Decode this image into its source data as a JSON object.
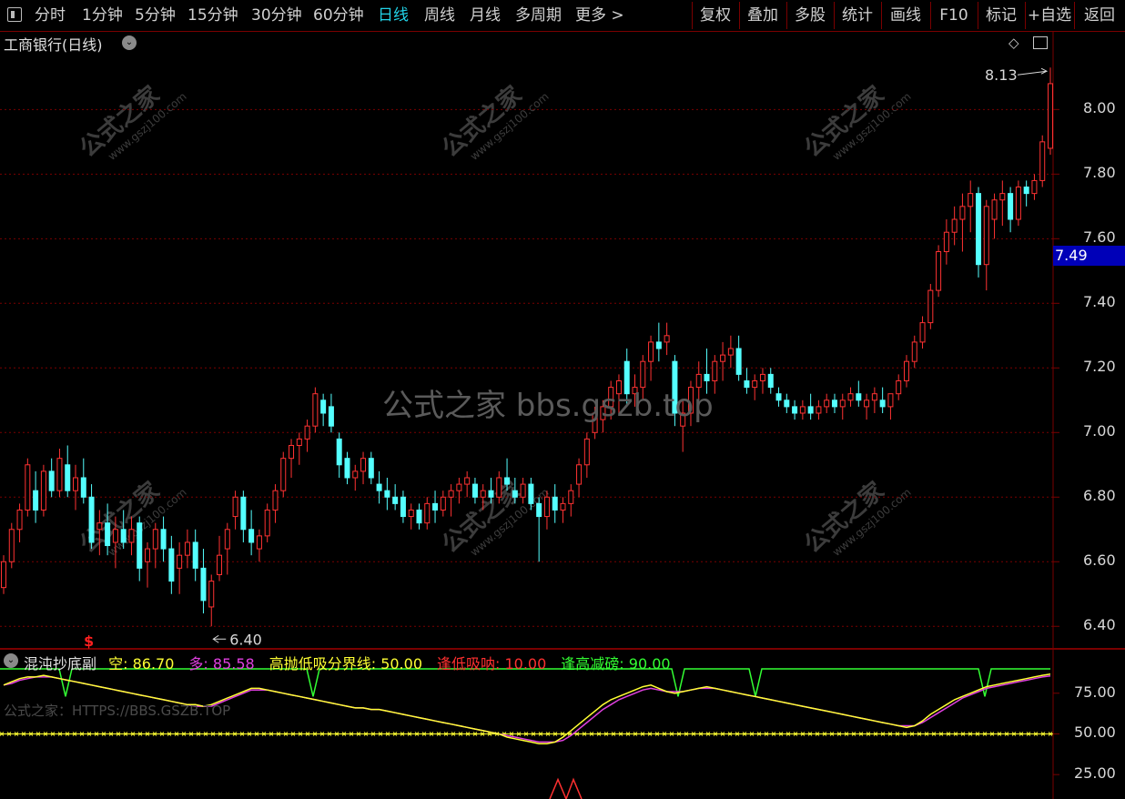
{
  "toolbar": {
    "left_items": [
      {
        "label": "分时",
        "active": false
      },
      {
        "label": "1分钟",
        "active": false
      },
      {
        "label": "5分钟",
        "active": false
      },
      {
        "label": "15分钟",
        "active": false
      },
      {
        "label": "30分钟",
        "active": false
      },
      {
        "label": "60分钟",
        "active": false
      },
      {
        "label": "日线",
        "active": true
      },
      {
        "label": "周线",
        "active": false
      },
      {
        "label": "月线",
        "active": false
      },
      {
        "label": "多周期",
        "active": false
      },
      {
        "label": "更多 >",
        "active": false
      }
    ],
    "right_items": [
      "复权",
      "叠加",
      "多股",
      "统计",
      "画线",
      "F10",
      "标记",
      "+自选",
      "返回"
    ]
  },
  "chart": {
    "title": "工商银行(日线)",
    "current_price": "7.49",
    "high_label": "8.13",
    "low_label": "6.40",
    "signal_marker": "$",
    "watermark_center": "公式之家 bbs.gszb.top",
    "watermark_cn": "公式之家",
    "watermark_url": "www.gszj100.com",
    "price_ticks": [
      "8.00",
      "7.80",
      "7.60",
      "7.40",
      "7.20",
      "7.00",
      "6.80",
      "6.60",
      "6.40"
    ]
  },
  "indicator": {
    "name": "混沌抄底副",
    "fields": [
      {
        "label": "空: ",
        "value": "86.70",
        "color": "#ffff33"
      },
      {
        "label": "多: ",
        "value": "85.58",
        "color": "#e040e0"
      },
      {
        "label": "高抛低吸分界线: ",
        "value": "50.00",
        "color": "#ffff33"
      },
      {
        "label": "逢低吸呐: ",
        "value": "10.00",
        "color": "#ff3030"
      },
      {
        "label": "逢高减磅: ",
        "value": "90.00",
        "color": "#33ff33"
      }
    ],
    "axis_ticks": [
      "75.00",
      "50.00",
      "25.00"
    ],
    "watermark": "公式之家：HTTPS://BBS.GSZB.TOP"
  },
  "colors": {
    "up": "#ff3232",
    "down": "#54ffff",
    "grid": "#7a0000",
    "kong_line": "#ffff33",
    "duo_line": "#e040e0",
    "high_sell": "#33ff33",
    "low_buy": "#ff3030"
  },
  "chart_data": {
    "type": "candlestick",
    "ylim": [
      6.35,
      8.17
    ],
    "candles": [
      [
        6.52,
        6.62,
        6.5,
        6.6
      ],
      [
        6.6,
        6.72,
        6.58,
        6.7
      ],
      [
        6.7,
        6.78,
        6.66,
        6.76
      ],
      [
        6.76,
        6.92,
        6.74,
        6.9
      ],
      [
        6.82,
        6.88,
        6.72,
        6.76
      ],
      [
        6.76,
        6.9,
        6.74,
        6.88
      ],
      [
        6.88,
        6.92,
        6.8,
        6.82
      ],
      [
        6.82,
        6.95,
        6.8,
        6.92
      ],
      [
        6.9,
        6.96,
        6.8,
        6.82
      ],
      [
        6.82,
        6.9,
        6.76,
        6.86
      ],
      [
        6.86,
        6.92,
        6.78,
        6.8
      ],
      [
        6.8,
        6.84,
        6.64,
        6.66
      ],
      [
        6.7,
        6.76,
        6.62,
        6.72
      ],
      [
        6.72,
        6.78,
        6.62,
        6.65
      ],
      [
        6.66,
        6.74,
        6.58,
        6.7
      ],
      [
        6.7,
        6.76,
        6.64,
        6.66
      ],
      [
        6.66,
        6.74,
        6.62,
        6.7
      ],
      [
        6.72,
        6.74,
        6.54,
        6.58
      ],
      [
        6.6,
        6.66,
        6.52,
        6.64
      ],
      [
        6.64,
        6.72,
        6.58,
        6.7
      ],
      [
        6.7,
        6.74,
        6.6,
        6.64
      ],
      [
        6.64,
        6.68,
        6.5,
        6.54
      ],
      [
        6.58,
        6.66,
        6.5,
        6.62
      ],
      [
        6.62,
        6.7,
        6.58,
        6.66
      ],
      [
        6.66,
        6.7,
        6.54,
        6.58
      ],
      [
        6.58,
        6.64,
        6.44,
        6.48
      ],
      [
        6.46,
        6.56,
        6.4,
        6.54
      ],
      [
        6.56,
        6.68,
        6.54,
        6.62
      ],
      [
        6.64,
        6.72,
        6.56,
        6.7
      ],
      [
        6.74,
        6.82,
        6.7,
        6.8
      ],
      [
        6.8,
        6.82,
        6.66,
        6.7
      ],
      [
        6.7,
        6.76,
        6.62,
        6.66
      ],
      [
        6.64,
        6.7,
        6.6,
        6.68
      ],
      [
        6.68,
        6.78,
        6.66,
        6.76
      ],
      [
        6.76,
        6.84,
        6.72,
        6.82
      ],
      [
        6.82,
        6.94,
        6.8,
        6.92
      ],
      [
        6.92,
        6.98,
        6.86,
        6.96
      ],
      [
        6.96,
        7.0,
        6.9,
        6.98
      ],
      [
        6.98,
        7.04,
        6.94,
        7.02
      ],
      [
        7.02,
        7.14,
        7.0,
        7.12
      ],
      [
        7.1,
        7.12,
        7.02,
        7.06
      ],
      [
        7.08,
        7.12,
        7.0,
        7.02
      ],
      [
        6.98,
        7.0,
        6.86,
        6.9
      ],
      [
        6.92,
        6.94,
        6.84,
        6.86
      ],
      [
        6.86,
        6.9,
        6.82,
        6.88
      ],
      [
        6.88,
        6.94,
        6.84,
        6.92
      ],
      [
        6.92,
        6.94,
        6.84,
        6.86
      ],
      [
        6.84,
        6.88,
        6.78,
        6.82
      ],
      [
        6.82,
        6.86,
        6.76,
        6.8
      ],
      [
        6.8,
        6.84,
        6.76,
        6.78
      ],
      [
        6.8,
        6.82,
        6.72,
        6.74
      ],
      [
        6.74,
        6.78,
        6.7,
        6.76
      ],
      [
        6.76,
        6.78,
        6.7,
        6.72
      ],
      [
        6.72,
        6.8,
        6.7,
        6.78
      ],
      [
        6.78,
        6.82,
        6.72,
        6.76
      ],
      [
        6.76,
        6.82,
        6.74,
        6.8
      ],
      [
        6.8,
        6.84,
        6.74,
        6.82
      ],
      [
        6.82,
        6.86,
        6.78,
        6.84
      ],
      [
        6.84,
        6.88,
        6.8,
        6.86
      ],
      [
        6.84,
        6.86,
        6.78,
        6.8
      ],
      [
        6.8,
        6.84,
        6.76,
        6.82
      ],
      [
        6.82,
        6.86,
        6.78,
        6.8
      ],
      [
        6.8,
        6.88,
        6.78,
        6.86
      ],
      [
        6.86,
        6.92,
        6.82,
        6.84
      ],
      [
        6.82,
        6.86,
        6.78,
        6.8
      ],
      [
        6.8,
        6.86,
        6.78,
        6.84
      ],
      [
        6.84,
        6.86,
        6.76,
        6.78
      ],
      [
        6.78,
        6.8,
        6.6,
        6.74
      ],
      [
        6.74,
        6.82,
        6.7,
        6.8
      ],
      [
        6.8,
        6.84,
        6.72,
        6.76
      ],
      [
        6.76,
        6.8,
        6.72,
        6.78
      ],
      [
        6.78,
        6.84,
        6.74,
        6.82
      ],
      [
        6.84,
        6.92,
        6.8,
        6.9
      ],
      [
        6.9,
        7.0,
        6.86,
        6.98
      ],
      [
        7.0,
        7.08,
        6.98,
        7.06
      ],
      [
        7.04,
        7.1,
        7.0,
        7.08
      ],
      [
        7.08,
        7.16,
        7.04,
        7.14
      ],
      [
        7.12,
        7.18,
        7.06,
        7.16
      ],
      [
        7.22,
        7.26,
        7.08,
        7.12
      ],
      [
        7.12,
        7.18,
        7.08,
        7.14
      ],
      [
        7.14,
        7.24,
        7.1,
        7.22
      ],
      [
        7.22,
        7.3,
        7.16,
        7.28
      ],
      [
        7.28,
        7.34,
        7.22,
        7.26
      ],
      [
        7.28,
        7.34,
        7.24,
        7.3
      ],
      [
        7.22,
        7.24,
        7.02,
        7.06
      ],
      [
        7.02,
        7.1,
        6.94,
        7.06
      ],
      [
        7.06,
        7.16,
        7.02,
        7.14
      ],
      [
        7.14,
        7.22,
        7.1,
        7.18
      ],
      [
        7.18,
        7.26,
        7.12,
        7.16
      ],
      [
        7.16,
        7.24,
        7.12,
        7.22
      ],
      [
        7.22,
        7.28,
        7.16,
        7.24
      ],
      [
        7.24,
        7.3,
        7.2,
        7.26
      ],
      [
        7.26,
        7.3,
        7.16,
        7.18
      ],
      [
        7.16,
        7.2,
        7.12,
        7.14
      ],
      [
        7.14,
        7.18,
        7.1,
        7.16
      ],
      [
        7.16,
        7.2,
        7.12,
        7.18
      ],
      [
        7.18,
        7.2,
        7.12,
        7.14
      ],
      [
        7.12,
        7.14,
        7.08,
        7.1
      ],
      [
        7.1,
        7.12,
        7.06,
        7.08
      ],
      [
        7.08,
        7.1,
        7.04,
        7.06
      ],
      [
        7.06,
        7.1,
        7.04,
        7.08
      ],
      [
        7.08,
        7.12,
        7.04,
        7.06
      ],
      [
        7.06,
        7.1,
        7.04,
        7.08
      ],
      [
        7.08,
        7.12,
        7.06,
        7.1
      ],
      [
        7.1,
        7.12,
        7.06,
        7.08
      ],
      [
        7.08,
        7.12,
        7.04,
        7.1
      ],
      [
        7.1,
        7.14,
        7.08,
        7.12
      ],
      [
        7.12,
        7.16,
        7.08,
        7.1
      ],
      [
        7.08,
        7.12,
        7.04,
        7.1
      ],
      [
        7.1,
        7.14,
        7.06,
        7.12
      ],
      [
        7.1,
        7.14,
        7.06,
        7.08
      ],
      [
        7.08,
        7.12,
        7.04,
        7.12
      ],
      [
        7.12,
        7.18,
        7.1,
        7.16
      ],
      [
        7.16,
        7.24,
        7.14,
        7.22
      ],
      [
        7.22,
        7.3,
        7.2,
        7.28
      ],
      [
        7.28,
        7.36,
        7.26,
        7.34
      ],
      [
        7.34,
        7.46,
        7.32,
        7.44
      ],
      [
        7.44,
        7.58,
        7.42,
        7.56
      ],
      [
        7.56,
        7.66,
        7.52,
        7.62
      ],
      [
        7.62,
        7.7,
        7.58,
        7.66
      ],
      [
        7.66,
        7.74,
        7.56,
        7.7
      ],
      [
        7.7,
        7.78,
        7.62,
        7.74
      ],
      [
        7.74,
        7.76,
        7.48,
        7.52
      ],
      [
        7.52,
        7.72,
        7.44,
        7.7
      ],
      [
        7.66,
        7.74,
        7.6,
        7.72
      ],
      [
        7.72,
        7.78,
        7.64,
        7.74
      ],
      [
        7.74,
        7.76,
        7.62,
        7.66
      ],
      [
        7.66,
        7.78,
        7.64,
        7.76
      ],
      [
        7.76,
        7.78,
        7.7,
        7.74
      ],
      [
        7.74,
        7.8,
        7.72,
        7.78
      ],
      [
        7.78,
        7.92,
        7.76,
        7.9
      ],
      [
        7.88,
        8.13,
        7.86,
        8.08
      ]
    ],
    "kong": [
      80,
      82,
      84,
      85,
      85,
      86,
      85,
      84,
      83,
      82,
      81,
      80,
      79,
      78,
      77,
      76,
      75,
      74,
      73,
      72,
      71,
      70,
      69,
      68,
      68,
      67,
      68,
      70,
      72,
      74,
      76,
      78,
      78,
      77,
      76,
      75,
      74,
      73,
      72,
      71,
      70,
      69,
      68,
      67,
      66,
      66,
      65,
      65,
      64,
      63,
      62,
      61,
      60,
      59,
      58,
      57,
      56,
      55,
      54,
      53,
      52,
      51,
      50,
      48,
      47,
      46,
      45,
      44,
      44,
      45,
      48,
      52,
      56,
      60,
      64,
      68,
      71,
      73,
      75,
      77,
      79,
      80,
      78,
      76,
      75,
      76,
      77,
      78,
      79,
      78,
      77,
      76,
      75,
      74,
      73,
      72,
      71,
      70,
      69,
      68,
      67,
      66,
      65,
      64,
      63,
      62,
      61,
      60,
      59,
      58,
      57,
      56,
      55,
      54,
      55,
      58,
      62,
      65,
      68,
      71,
      73,
      75,
      77,
      79,
      80,
      81,
      82,
      83,
      84,
      85,
      86,
      86.7
    ],
    "duo": [
      80,
      81,
      83,
      84,
      85,
      85,
      85,
      84,
      83,
      82,
      81,
      80,
      79,
      78,
      77,
      76,
      75,
      74,
      73,
      72,
      71,
      70,
      69,
      68,
      67,
      67,
      67,
      69,
      71,
      73,
      75,
      77,
      77,
      77,
      76,
      75,
      74,
      73,
      72,
      71,
      70,
      69,
      68,
      67,
      66,
      66,
      65,
      65,
      64,
      63,
      62,
      61,
      60,
      59,
      58,
      57,
      56,
      55,
      54,
      53,
      52,
      51,
      50,
      49,
      48,
      47,
      46,
      45,
      45,
      45,
      46,
      49,
      53,
      57,
      61,
      65,
      68,
      71,
      73,
      75,
      77,
      78,
      77,
      76,
      76,
      76,
      77,
      78,
      78,
      78,
      77,
      76,
      75,
      74,
      73,
      72,
      71,
      70,
      69,
      68,
      67,
      66,
      65,
      64,
      63,
      62,
      61,
      60,
      59,
      58,
      57,
      56,
      55,
      55,
      55,
      57,
      60,
      63,
      66,
      69,
      72,
      74,
      76,
      78,
      79,
      80,
      81,
      82,
      83,
      84,
      85,
      85.58
    ],
    "boundary": 50,
    "low_buy": 10,
    "high_sell": 90,
    "ind_ylim": [
      10,
      95
    ]
  }
}
